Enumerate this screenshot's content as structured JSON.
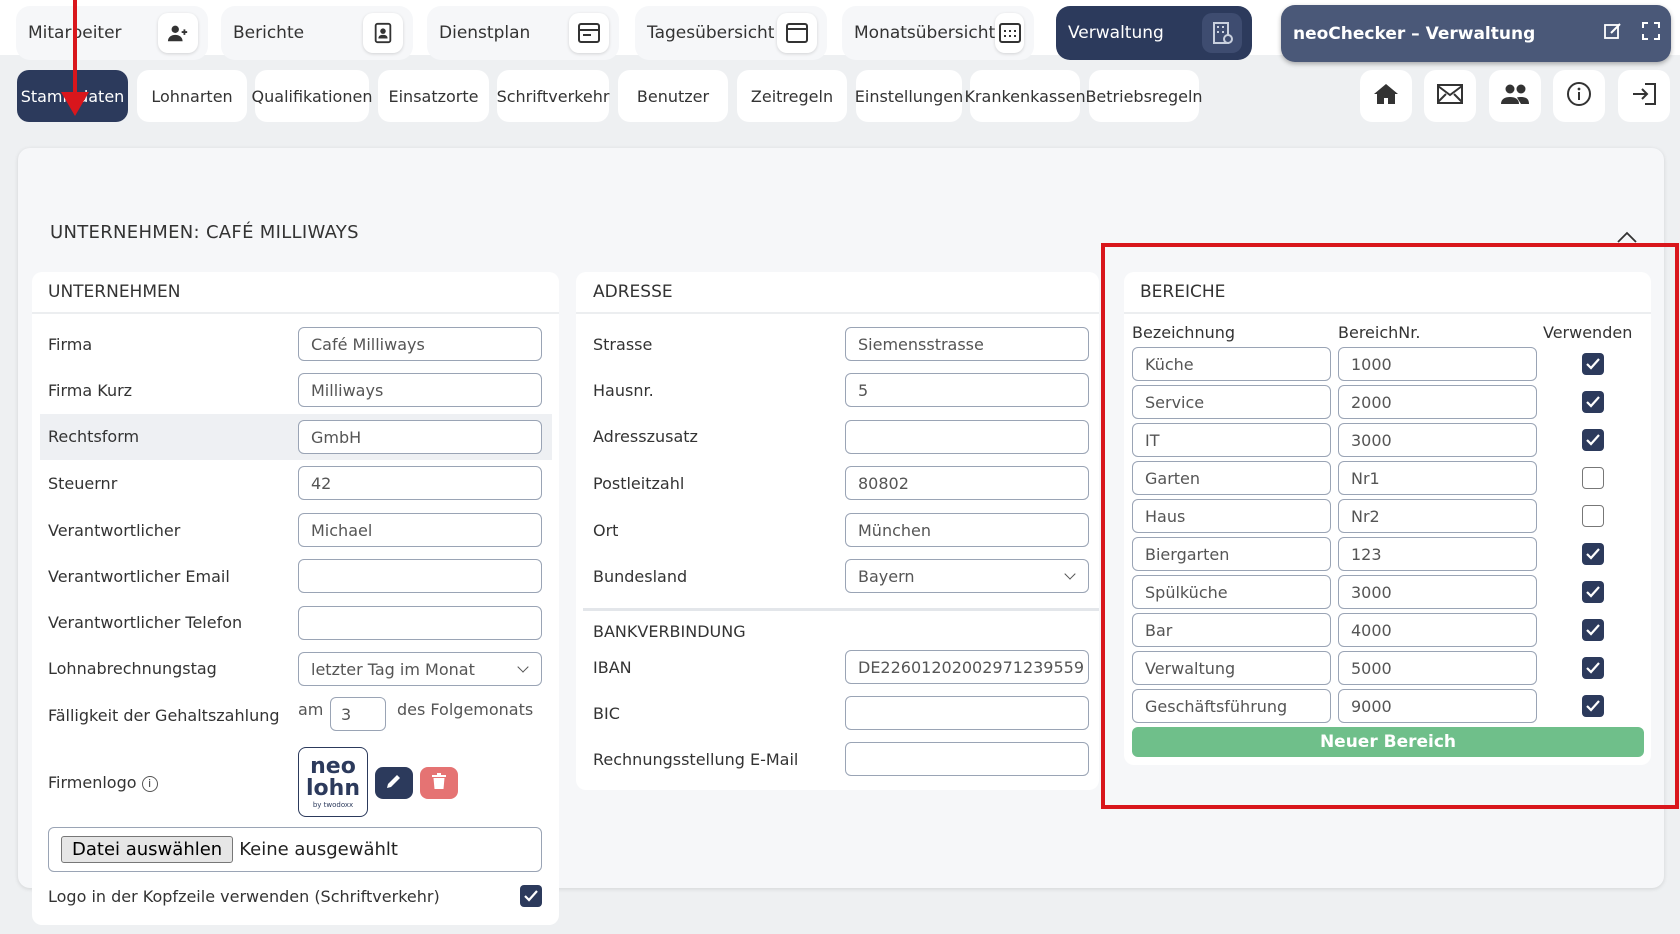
{
  "main_tabs": [
    {
      "label": "Mitarbeiter",
      "icon": "user-plus-icon"
    },
    {
      "label": "Berichte",
      "icon": "report-icon"
    },
    {
      "label": "Dienstplan",
      "icon": "schedule-icon"
    },
    {
      "label": "Tagesübersicht",
      "icon": "day-calendar-icon"
    },
    {
      "label": "Monatsübersicht",
      "icon": "month-calendar-icon"
    },
    {
      "label": "Verwaltung",
      "icon": "admin-building-icon"
    }
  ],
  "checker": {
    "title": "neoChecker – Verwaltung"
  },
  "sub_tabs": [
    "Stammdaten",
    "Lohnarten",
    "Qualifikationen",
    "Einsatzorte",
    "Schriftverkehr",
    "Benutzer",
    "Zeitregeln",
    "Einstellungen",
    "Krankenkassen",
    "Betriebsregeln"
  ],
  "card": {
    "title": "UNTERNEHMEN: CAFÉ MILLIWAYS"
  },
  "company": {
    "title": "UNTERNEHMEN",
    "firma_label": "Firma",
    "firma": "Café Milliways",
    "kurz_label": "Firma Kurz",
    "kurz": "Milliways",
    "rechtsform_label": "Rechtsform",
    "rechtsform": "GmbH",
    "steuer_label": "Steuernr",
    "steuer": "42",
    "verant_label": "Verantwortlicher",
    "verant": "Michael",
    "email_label": "Verantwortlicher Email",
    "email": "",
    "tel_label": "Verantwortlicher Telefon",
    "tel": "",
    "lohn_label": "Lohnabrechnungstag",
    "lohn": "letzter Tag im Monat",
    "faell_label": "Fälligkeit der Gehaltszahlung",
    "faell_am": "am",
    "faell_value": "3",
    "faell_suffix": "des Folgemonats",
    "logo_label": "Firmenlogo",
    "logo_top": "neo",
    "logo_mid": "lohn",
    "logo_sub": "by twodoxx",
    "file_button": "Datei auswählen",
    "file_status": "Keine ausgewählt",
    "logo_header_label": "Logo in der Kopfzeile verwenden (Schriftverkehr)"
  },
  "address": {
    "title": "ADRESSE",
    "strasse_label": "Strasse",
    "strasse": "Siemensstrasse",
    "hausnr_label": "Hausnr.",
    "hausnr": "5",
    "zusatz_label": "Adresszusatz",
    "zusatz": "",
    "plz_label": "Postleitzahl",
    "plz": "80802",
    "ort_label": "Ort",
    "ort": "München",
    "land_label": "Bundesland",
    "land": "Bayern",
    "bank_title": "BANKVERBINDUNG",
    "iban_label": "IBAN",
    "iban": "DE22601202002971239559",
    "bic_label": "BIC",
    "bic": "",
    "rechnung_label": "Rechnungsstellung E-Mail",
    "rechnung": ""
  },
  "areas": {
    "title": "BEREICHE",
    "col_name": "Bezeichnung",
    "col_nr": "BereichNr.",
    "col_use": "Verwenden",
    "rows": [
      {
        "name": "Küche",
        "nr": "1000",
        "use": true
      },
      {
        "name": "Service",
        "nr": "2000",
        "use": true
      },
      {
        "name": "IT",
        "nr": "3000",
        "use": true
      },
      {
        "name": "Garten",
        "nr": "Nr1",
        "use": false
      },
      {
        "name": "Haus",
        "nr": "Nr2",
        "use": false
      },
      {
        "name": "Biergarten",
        "nr": "123",
        "use": true
      },
      {
        "name": "Spülküche",
        "nr": "3000",
        "use": true
      },
      {
        "name": "Bar",
        "nr": "4000",
        "use": true
      },
      {
        "name": "Verwaltung",
        "nr": "5000",
        "use": true
      },
      {
        "name": "Geschäftsführung",
        "nr": "9000",
        "use": true
      }
    ],
    "new_button": "Neuer Bereich"
  },
  "colors": {
    "primary": "#2c3a5c",
    "accent_green": "#6fbf8a",
    "highlight": "#d9161c",
    "delete": "#e57373"
  }
}
